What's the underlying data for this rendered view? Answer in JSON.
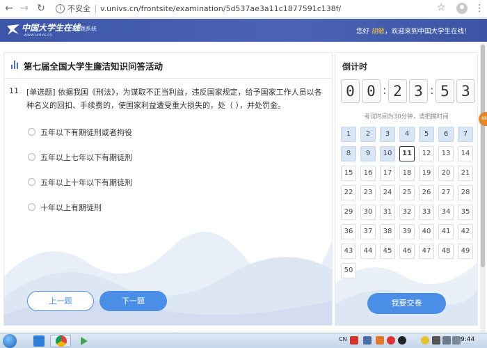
{
  "browser": {
    "insecure_label": "不安全",
    "url": "v.univs.cn/frontsite/examination/5d537ae3a11c1877591c138f/"
  },
  "header": {
    "logo_text": "中国大学生在线",
    "logo_sub": "www.univs.cn",
    "logo_suffix": "答题系统",
    "greeting_prefix": "您好 ",
    "username": "胡敏",
    "greeting_suffix": "，欢迎来到中国大学生在线！"
  },
  "exam": {
    "title": "第七届全国大学生廉洁知识问答活动",
    "question_number": "11",
    "question_type": "[单选题]",
    "question_text": " 依据我国《刑法》，为谋取不正当利益，违反国家规定，给予国家工作人员以各种名义的回扣、手续费的，使国家利益遭受重大损失的，处（ ），并处罚金。",
    "options": [
      "五年以下有期徒刑或者拘役",
      "五年以上七年以下有期徒刑",
      "五年以上十年以下有期徒刑",
      "十年以上有期徒刑"
    ],
    "prev_label": "上一题",
    "next_label": "下一题"
  },
  "sidebar": {
    "countdown_title": "倒计时",
    "timer_digits": [
      "0",
      "0",
      "2",
      "3",
      "5",
      "3"
    ],
    "timer_note": "考试时间为30分钟，请把握时间",
    "questions": [
      "1",
      "2",
      "3",
      "4",
      "5",
      "6",
      "7",
      "8",
      "9",
      "10",
      "11",
      "12",
      "13",
      "14",
      "15",
      "16",
      "17",
      "18",
      "19",
      "20",
      "21",
      "22",
      "23",
      "24",
      "25",
      "26",
      "27",
      "28",
      "29",
      "30",
      "31",
      "32",
      "33",
      "34",
      "35",
      "36",
      "37",
      "38",
      "39",
      "40",
      "41",
      "42",
      "43",
      "44",
      "45",
      "46",
      "47",
      "48",
      "49",
      "50"
    ],
    "answered_count": 10,
    "current_question": 11,
    "submit_label": "我要交卷"
  },
  "widgets": {
    "float_badge": "88"
  },
  "taskbar": {
    "lang": "CN",
    "clock": "9:44"
  },
  "colors": {
    "header_blue": "#3b56a8",
    "accent_blue": "#4a8ee8",
    "answered_cell": "#d9e6f5",
    "username_gold": "#f5c542"
  }
}
